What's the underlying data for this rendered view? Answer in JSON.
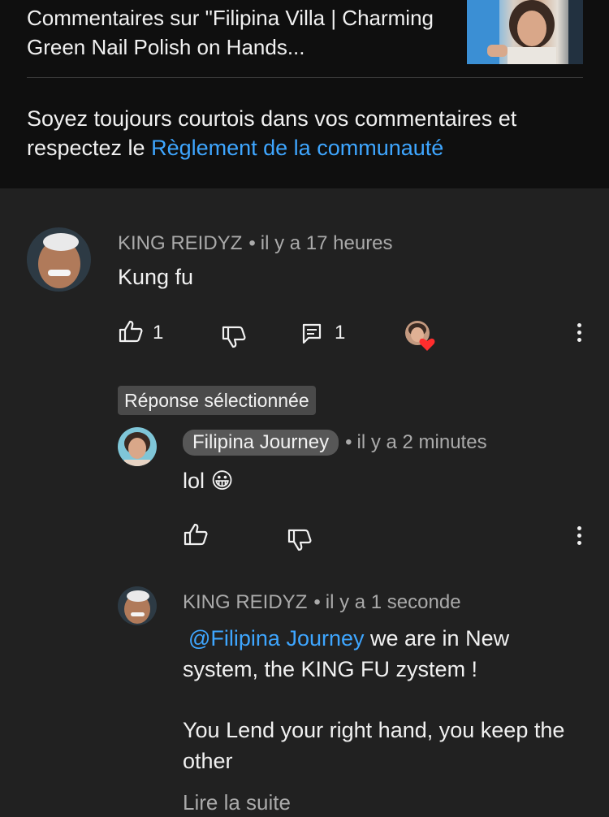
{
  "header": {
    "title": "Commentaires sur \"Filipina Villa | Charming Green Nail Polish on Hands...",
    "notice_text": "Soyez toujours courtois dans vos commentaires et respectez le ",
    "notice_link": "Règlement de la communauté"
  },
  "comment": {
    "author": "KING REIDYZ",
    "time": "il y a 17 heures",
    "text": "Kung fu",
    "likes": "1",
    "replies": "1"
  },
  "selected_reply_label": "Réponse sélectionnée",
  "reply1": {
    "author": "Filipina Journey",
    "time": "il y a 2 minutes",
    "text": "lol 😀"
  },
  "reply2": {
    "author": "KING REIDYZ",
    "time": "il y a 1 seconde",
    "mention": "@Filipina Journey",
    "text_part1": " we are in New system, the KING FU zystem !",
    "text_part2": "You Lend your right hand, you keep the other",
    "read_more": "Lire la suite"
  },
  "icons": [
    "like-icon",
    "dislike-icon",
    "reply-icon",
    "heart-icon",
    "more-vert-icon"
  ],
  "colors": {
    "link": "#3ea6ff",
    "heart": "#ff2d2d"
  }
}
